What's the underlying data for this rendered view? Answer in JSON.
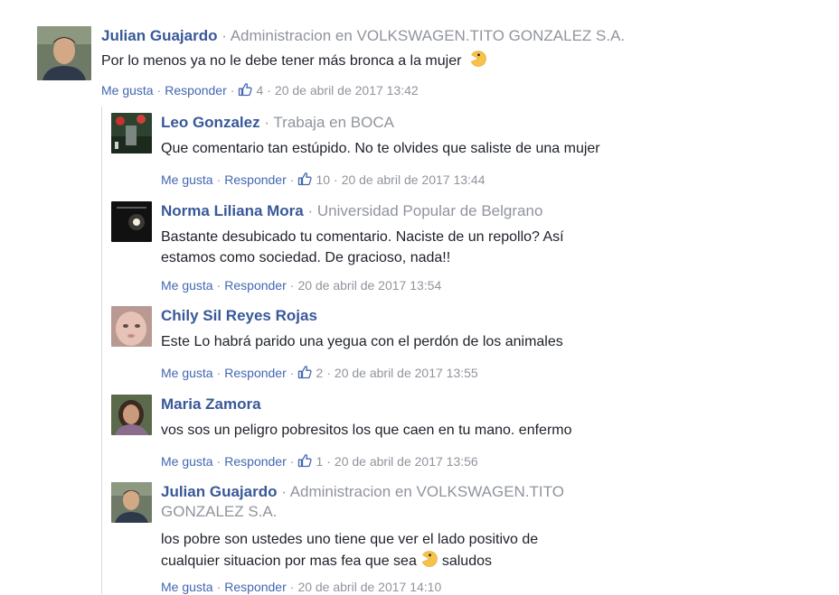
{
  "colors": {
    "name": "#385898",
    "link": "#4267b2",
    "meta": "#90949c",
    "text": "#1d2129"
  },
  "separator": "·",
  "top_comment": {
    "author": "Julian Guajardo",
    "work": "Administracion en VOLKSWAGEN.TITO GONZALEZ S.A.",
    "text": "Por lo menos ya no le debe tener más bronca a la mujer",
    "emoji": "pacman-emoji",
    "like_label": "Me gusta",
    "reply_label": "Responder",
    "like_count": "4",
    "timestamp": "20 de abril de 2017 13:42"
  },
  "replies": [
    {
      "author": "Leo Gonzalez",
      "work": "Trabaja en BOCA",
      "text": "Que comentario tan estúpido. No te olvides que saliste de una mujer",
      "like_label": "Me gusta",
      "reply_label": "Responder",
      "like_count": "10",
      "timestamp": "20 de abril de 2017 13:44"
    },
    {
      "author": "Norma Liliana Mora",
      "work": "Universidad Popular de Belgrano",
      "text": "Bastante desubicado tu comentario. Naciste de un repollo? Así estamos como sociedad. De gracioso, nada!!",
      "like_label": "Me gusta",
      "reply_label": "Responder",
      "timestamp": "20 de abril de 2017 13:54"
    },
    {
      "author": "Chily Sil Reyes Rojas",
      "text": "Este Lo habrá parido una yegua con el perdón de los animales",
      "like_label": "Me gusta",
      "reply_label": "Responder",
      "like_count": "2",
      "timestamp": "20 de abril de 2017 13:55"
    },
    {
      "author": "Maria Zamora",
      "text": "vos sos un peligro pobresitos los que caen en tu mano. enfermo",
      "like_label": "Me gusta",
      "reply_label": "Responder",
      "like_count": "1",
      "timestamp": "20 de abril de 2017 13:56"
    },
    {
      "author": "Julian Guajardo",
      "work": "Administracion en VOLKSWAGEN.TITO GONZALEZ S.A.",
      "text_before_emoji": "los pobre son ustedes uno tiene que ver el lado positivo de cualquier situacion por mas fea que sea",
      "emoji": "pacman-emoji",
      "text_after_emoji": "saludos",
      "like_label": "Me gusta",
      "reply_label": "Responder",
      "timestamp": "20 de abril de 2017 14:10"
    }
  ]
}
